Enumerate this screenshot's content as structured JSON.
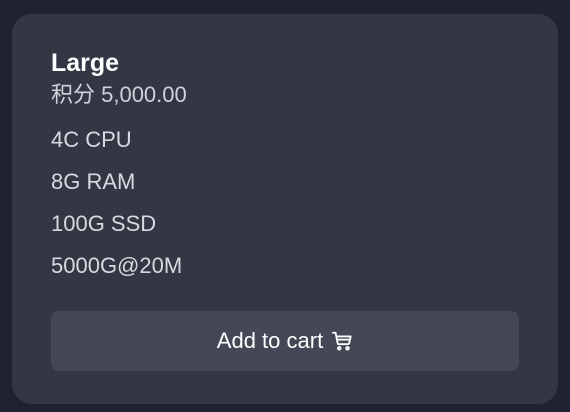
{
  "product": {
    "name": "Large",
    "price": "积分 5,000.00",
    "specs": [
      {
        "label": "4C CPU"
      },
      {
        "label": "8G RAM"
      },
      {
        "label": "100G SSD"
      },
      {
        "label": "5000G@20M"
      }
    ],
    "add_to_cart_label": "Add to cart",
    "cart_icon": "shopping-cart-icon"
  },
  "colors": {
    "page_background": "#1f2230",
    "card_background": "#333744",
    "button_background": "#434756",
    "text_primary": "#ffffff",
    "text_secondary": "#d7d9e0"
  }
}
